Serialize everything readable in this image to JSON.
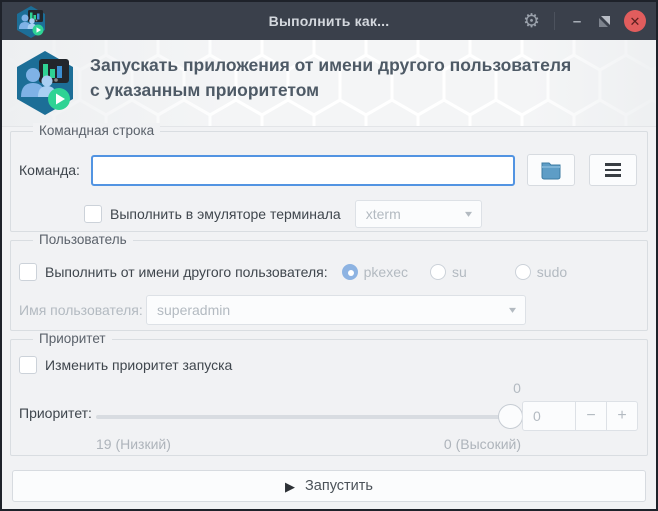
{
  "window": {
    "title": "Выполнить как..."
  },
  "icons": {
    "gear": "⚙",
    "minimize": "–",
    "close": "✕",
    "dropdown_arrow": "▾",
    "run_play": "▶",
    "spin_minus": "−",
    "spin_plus": "+"
  },
  "header": {
    "title_line1": "Запускать приложения от имени другого пользователя",
    "title_line2": "с указанным приоритетом"
  },
  "command_group": {
    "legend": "Командная строка",
    "command_label": "Команда:",
    "command_value": "",
    "terminal_checkbox_label": "Выполнить в эмуляторе терминала",
    "terminal_select_value": "xterm"
  },
  "user_group": {
    "legend": "Пользователь",
    "run_as_checkbox_label": "Выполнить от имени другого пользователя:",
    "radios": [
      {
        "label": "pkexec",
        "selected": true
      },
      {
        "label": "su",
        "selected": false
      },
      {
        "label": "sudo",
        "selected": false
      }
    ],
    "username_label": "Имя пользователя:",
    "username_value": "superadmin"
  },
  "priority_group": {
    "legend": "Приоритет",
    "change_checkbox_label": "Изменить приоритет запуска",
    "priority_label": "Приоритет:",
    "slider_value": "0",
    "spin_value": "0",
    "low_label": "19 (Низкий)",
    "high_label": "0 (Высокий)"
  },
  "run_button": {
    "label": "Запустить"
  },
  "colors": {
    "accent_blue": "#5294e2",
    "titlebar": "#3a404b",
    "close_button": "#e15d5d",
    "icon_teal": "#1c6e97",
    "icon_green": "#2fd394"
  }
}
